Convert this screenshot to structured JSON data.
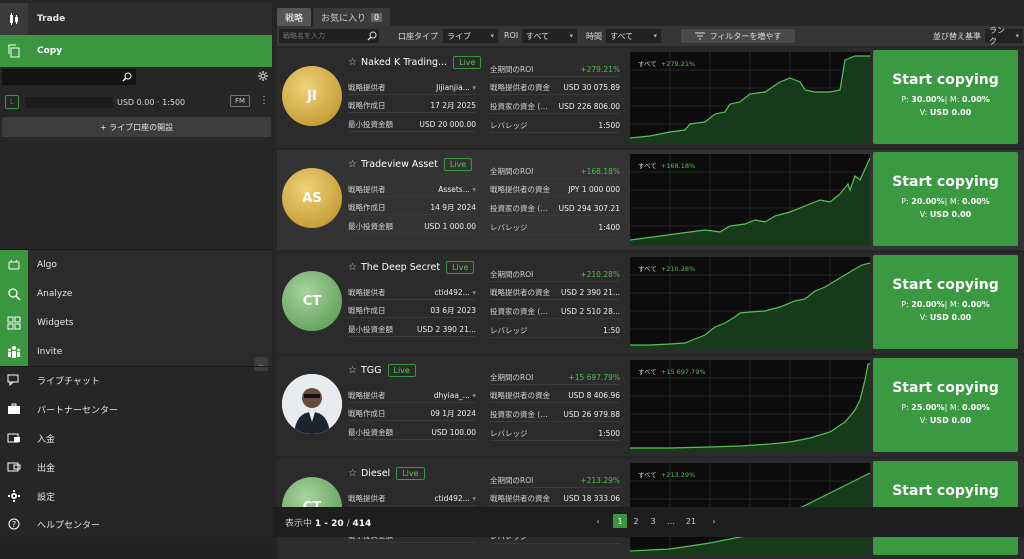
{
  "sidebar": {
    "top_items": [
      {
        "label": "Trade",
        "icon": "trade-icon"
      },
      {
        "label": "Copy",
        "icon": "copy-icon"
      }
    ],
    "account": {
      "type": "L",
      "balance": "USD 0.00 · 1:500",
      "badge": "FM"
    },
    "open_live_label": "+ ライブ口座の開設",
    "mid_items": [
      {
        "label": "Algo",
        "icon": "algo-icon"
      },
      {
        "label": "Analyze",
        "icon": "analyze-icon"
      },
      {
        "label": "Widgets",
        "icon": "widgets-icon"
      },
      {
        "label": "Invite",
        "icon": "invite-icon"
      }
    ],
    "bottom_items": [
      {
        "label": "ライブチャット",
        "icon": "chat-icon"
      },
      {
        "label": "パートナーセンター",
        "icon": "briefcase-icon"
      },
      {
        "label": "入金",
        "icon": "deposit-icon"
      },
      {
        "label": "出金",
        "icon": "withdraw-icon"
      },
      {
        "label": "設定",
        "icon": "gear-icon"
      },
      {
        "label": "ヘルプセンター",
        "icon": "help-icon"
      }
    ]
  },
  "tabs": [
    {
      "label": "戦略"
    },
    {
      "label": "お気に入り",
      "count": "0"
    }
  ],
  "filters": {
    "search_placeholder": "戦略名を入力",
    "account_type_label": "口座タイプ",
    "account_type_value": "ライブ",
    "roi_label": "ROI",
    "roi_value": "すべて",
    "time_label": "時間",
    "time_value": "すべて",
    "more_filters": "フィルターを増やす",
    "sort_label": "並び替え基準",
    "sort_value": "ランク"
  },
  "labels": {
    "provider": "戦略提供者",
    "created": "戦略作成日",
    "min_invest": "最小投資金額",
    "total_roi": "全期間のROI",
    "provider_funds": "戦略提供者の資金",
    "investor_funds": "投資家の資金 (…",
    "leverage": "レバレッジ",
    "start_copying": "Start copying",
    "chart_all": "すべて",
    "live": "Live"
  },
  "strategies": [
    {
      "initials": "JI",
      "name": "Naked K Trading...",
      "provider": "Jijianjia...",
      "created": "17 2月 2025",
      "min_invest": "USD 20 000.00",
      "roi": "+279.21%",
      "provider_funds": "USD 30 075.89",
      "investor_funds": "USD 226 806.00",
      "leverage": "1:500",
      "perf_fee": "30.00%",
      "mgmt_fee": "0.00%",
      "vol_fee": "USD 0.00"
    },
    {
      "initials": "AS",
      "name": "Tradeview Asset",
      "provider": "Assets...",
      "created": "14 9月 2024",
      "min_invest": "USD 1 000.00",
      "roi": "+168.18%",
      "provider_funds": "JPY 1 000 000",
      "investor_funds": "USD 294 307.21",
      "leverage": "1:400",
      "perf_fee": "20.00%",
      "mgmt_fee": "0.00%",
      "vol_fee": "USD 0.00"
    },
    {
      "initials": "CT",
      "name": "The Deep Secret",
      "provider": "ctid492...",
      "created": "03 6月 2023",
      "min_invest": "USD 2 390 21...",
      "roi": "+210.28%",
      "provider_funds": "USD 2 390 21...",
      "investor_funds": "USD 2 510 28...",
      "leverage": "1:50",
      "perf_fee": "20.00%",
      "mgmt_fee": "0.00%",
      "vol_fee": "USD 0.00"
    },
    {
      "initials": "",
      "name": "TGG",
      "provider": "dhyiaa_...",
      "created": "09 1月 2024",
      "min_invest": "USD 100.00",
      "roi": "+15 697.79%",
      "provider_funds": "USD 8 406.96",
      "investor_funds": "USD 26 979.88",
      "leverage": "1:500",
      "perf_fee": "25.00%",
      "mgmt_fee": "0.00%",
      "vol_fee": "USD 0.00"
    },
    {
      "initials": "CT",
      "name": "Diesel",
      "provider": "ctid492...",
      "created": "",
      "min_invest": "",
      "roi": "+213.29%",
      "provider_funds": "USD 18 333.06",
      "investor_funds": "",
      "leverage": "",
      "perf_fee": "",
      "mgmt_fee": "",
      "vol_fee": ""
    }
  ],
  "fee_labels": {
    "p": "P:",
    "m": "M:",
    "v": "V:"
  },
  "footer": {
    "showing_label": "表示中",
    "range": "1 - 20",
    "sep": "/",
    "total": "414",
    "pages": [
      "1",
      "2",
      "3",
      "...",
      "21"
    ],
    "prev": "‹",
    "next": "›"
  },
  "colors": {
    "accent": "#3a963f",
    "positive": "#4fbf4f",
    "chart_bg": "#0c0c0c"
  }
}
